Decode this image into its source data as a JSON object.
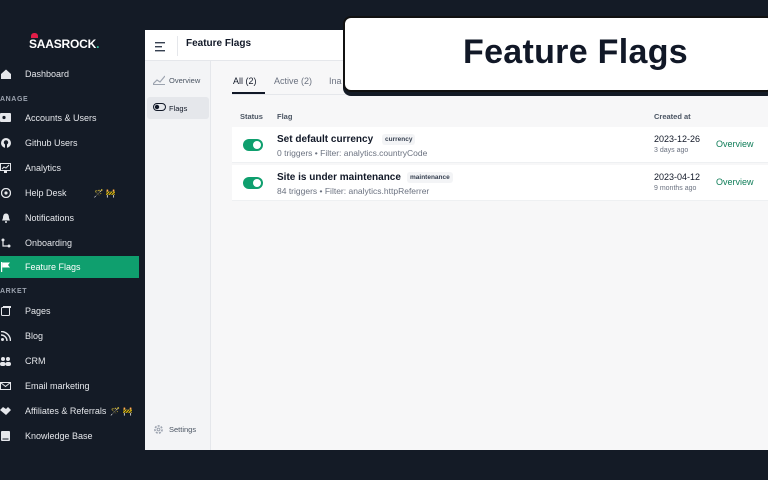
{
  "brand": {
    "logo_text": "SAASROCK",
    "logo_dot": "."
  },
  "sidebar": {
    "dashboard": {
      "label": "Dashboard",
      "icon": "home-icon"
    },
    "section_manage": "ANAGE",
    "manage_items": [
      {
        "label": "Accounts & Users",
        "icon": "id-card-icon"
      },
      {
        "label": "Github Users",
        "icon": "github-icon"
      },
      {
        "label": "Analytics",
        "icon": "analytics-icon"
      },
      {
        "label": "Help Desk",
        "icon": "help-icon",
        "badge": "🪄 🚧"
      },
      {
        "label": "Notifications",
        "icon": "bell-icon"
      },
      {
        "label": "Onboarding",
        "icon": "onboarding-icon"
      },
      {
        "label": "Feature Flags",
        "icon": "flag-icon",
        "active": true
      }
    ],
    "section_market": "ARKET",
    "market_items": [
      {
        "label": "Pages",
        "icon": "pages-icon"
      },
      {
        "label": "Blog",
        "icon": "rss-icon"
      },
      {
        "label": "CRM",
        "icon": "people-icon"
      },
      {
        "label": "Email marketing",
        "icon": "mail-icon"
      },
      {
        "label": "Affiliates & Referrals",
        "icon": "handshake-icon",
        "badge": "🪄 🚧"
      },
      {
        "label": "Knowledge Base",
        "icon": "book-icon"
      }
    ]
  },
  "header": {
    "title": "Feature Flags"
  },
  "subnav": {
    "overview": "Overview",
    "flags": "Flags",
    "settings": "Settings"
  },
  "tabs": [
    {
      "label": "All (2)",
      "active": true
    },
    {
      "label": "Active (2)"
    },
    {
      "label": "Ina"
    }
  ],
  "table": {
    "headers": {
      "status": "Status",
      "flag": "Flag",
      "created": "Created at"
    },
    "rows": [
      {
        "name": "Set default currency",
        "tag": "currency",
        "meta": "0 triggers  •  Filter: analytics.countryCode",
        "created": "2023-12-26",
        "created_rel": "3 days ago",
        "action": "Overview",
        "enabled": true
      },
      {
        "name": "Site is under maintenance",
        "tag": "maintenance",
        "meta": "84 triggers  •  Filter: analytics.httpReferrer",
        "created": "2023-04-12",
        "created_rel": "9 months ago",
        "action": "Overview",
        "enabled": true
      }
    ]
  },
  "overlay": {
    "title": "Feature Flags"
  },
  "colors": {
    "accent": "#0f9f6e",
    "sidebar_bg": "#141b26",
    "link": "#0f7d58"
  }
}
